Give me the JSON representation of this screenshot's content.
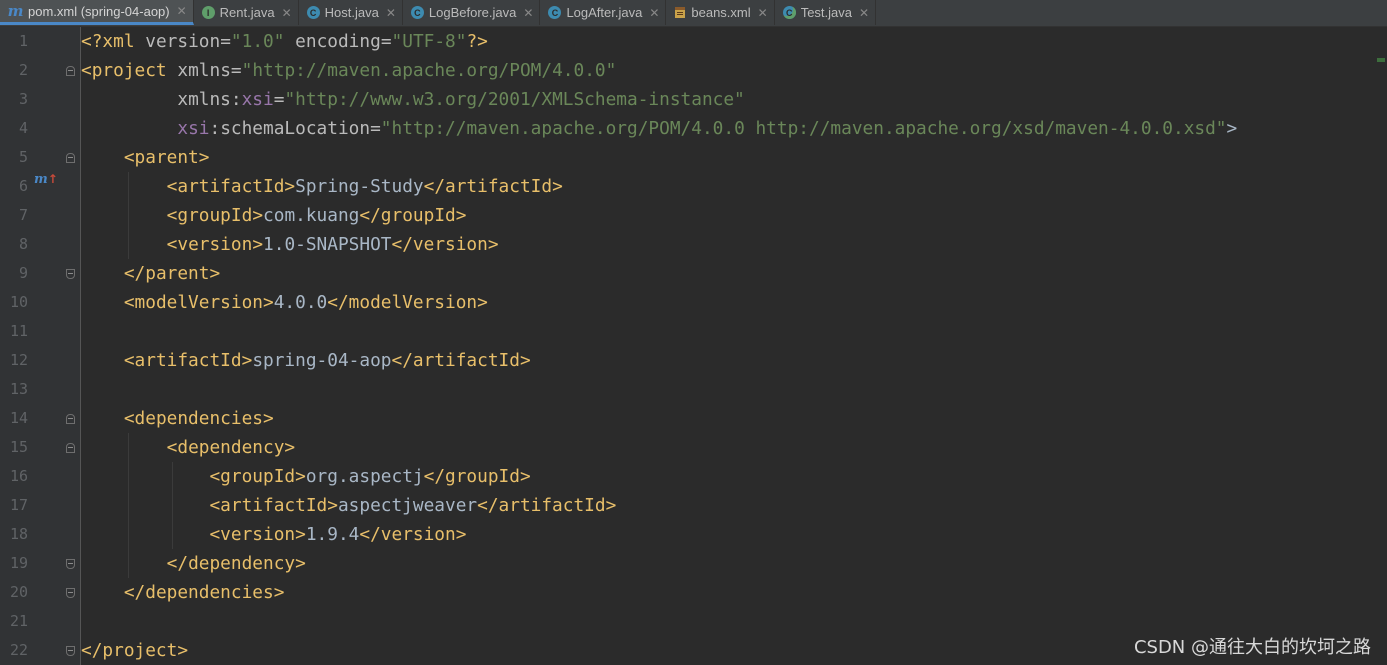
{
  "tabs": [
    {
      "label": "pom.xml (spring-04-aop)",
      "icon": "maven-icon",
      "glyph": "m",
      "active": true
    },
    {
      "label": "Rent.java",
      "icon": "interface-icon",
      "glyph": "I"
    },
    {
      "label": "Host.java",
      "icon": "class-icon",
      "glyph": "C"
    },
    {
      "label": "LogBefore.java",
      "icon": "class-icon",
      "glyph": "C"
    },
    {
      "label": "LogAfter.java",
      "icon": "class-icon",
      "glyph": "C"
    },
    {
      "label": "beans.xml",
      "icon": "xml-file-icon",
      "glyph": ""
    },
    {
      "label": "Test.java",
      "icon": "test-class-icon",
      "glyph": "C"
    }
  ],
  "close_glyph": "✕",
  "gutter_marker": {
    "glyph": "m",
    "arrow": "↑"
  },
  "code_lines": [
    {
      "n": "1",
      "text": "<?xml version=\"1.0\" encoding=\"UTF-8\"?>"
    },
    {
      "n": "2",
      "text": "<project xmlns=\"http://maven.apache.org/POM/4.0.0\""
    },
    {
      "n": "3",
      "text": "         xmlns:xsi=\"http://www.w3.org/2001/XMLSchema-instance\""
    },
    {
      "n": "4",
      "text": "         xsi:schemaLocation=\"http://maven.apache.org/POM/4.0.0 http://maven.apache.org/xsd/maven-4.0.0.xsd\">"
    },
    {
      "n": "5",
      "text": "    <parent>"
    },
    {
      "n": "6",
      "text": "        <artifactId>Spring-Study</artifactId>"
    },
    {
      "n": "7",
      "text": "        <groupId>com.kuang</groupId>"
    },
    {
      "n": "8",
      "text": "        <version>1.0-SNAPSHOT</version>"
    },
    {
      "n": "9",
      "text": "    </parent>"
    },
    {
      "n": "10",
      "text": "    <modelVersion>4.0.0</modelVersion>"
    },
    {
      "n": "11",
      "text": ""
    },
    {
      "n": "12",
      "text": "    <artifactId>spring-04-aop</artifactId>"
    },
    {
      "n": "13",
      "text": ""
    },
    {
      "n": "14",
      "text": "    <dependencies>"
    },
    {
      "n": "15",
      "text": "        <dependency>"
    },
    {
      "n": "16",
      "text": "            <groupId>org.aspectj</groupId>"
    },
    {
      "n": "17",
      "text": "            <artifactId>aspectjweaver</artifactId>"
    },
    {
      "n": "18",
      "text": "            <version>1.9.4</version>"
    },
    {
      "n": "19",
      "text": "        </dependency>"
    },
    {
      "n": "20",
      "text": "    </dependencies>"
    },
    {
      "n": "21",
      "text": ""
    },
    {
      "n": "22",
      "text": "</project>"
    }
  ],
  "watermark": "CSDN @通往大白的坎坷之路",
  "colors": {
    "background": "#2b2b2b",
    "tag": "#e8bf6a",
    "attribute": "#bababa",
    "namespace": "#9876aa",
    "string": "#6a8759",
    "text": "#a9b7c6"
  }
}
